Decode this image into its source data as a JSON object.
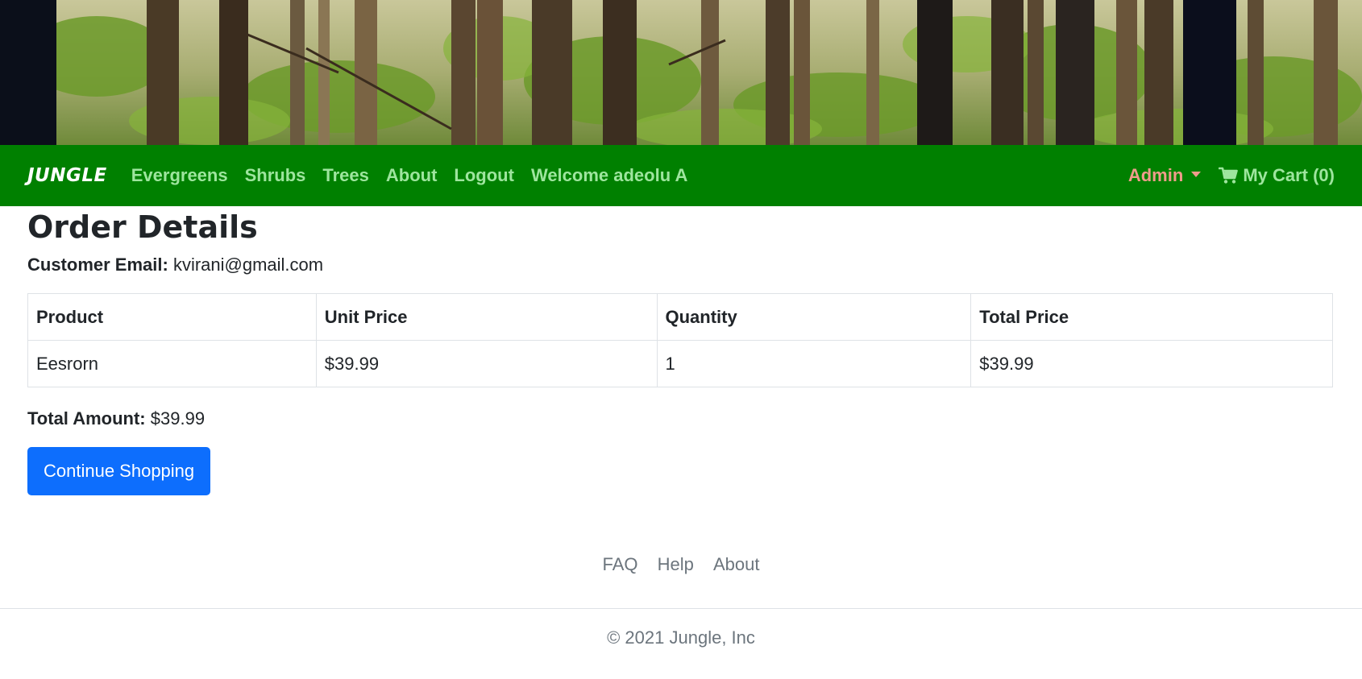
{
  "hero": {
    "image": "forest-banner"
  },
  "navbar": {
    "brand": "JUNGLE",
    "links": [
      {
        "label": "Evergreens"
      },
      {
        "label": "Shrubs"
      },
      {
        "label": "Trees"
      },
      {
        "label": "About"
      },
      {
        "label": "Logout"
      },
      {
        "label": "Welcome adeolu A"
      }
    ],
    "admin_label": "Admin",
    "cart_label": "My Cart (0)",
    "cart_icon": "shopping-cart-icon",
    "colors": {
      "background": "#008000",
      "link": "#9ee59e",
      "admin": "#f09c8c"
    }
  },
  "order": {
    "title": "Order Details",
    "email_label": "Customer Email:",
    "email_value": "kvirani@gmail.com",
    "table": {
      "headers": [
        "Product",
        "Unit Price",
        "Quantity",
        "Total Price"
      ],
      "rows": [
        [
          "Eesrorn",
          "$39.99",
          "1",
          "$39.99"
        ]
      ]
    },
    "total_label": "Total Amount:",
    "total_value": "$39.99",
    "continue_label": "Continue Shopping",
    "button_color": "#0d6efd"
  },
  "footer": {
    "links": [
      "FAQ",
      "Help",
      "About"
    ],
    "copyright": "© 2021 Jungle, Inc"
  }
}
